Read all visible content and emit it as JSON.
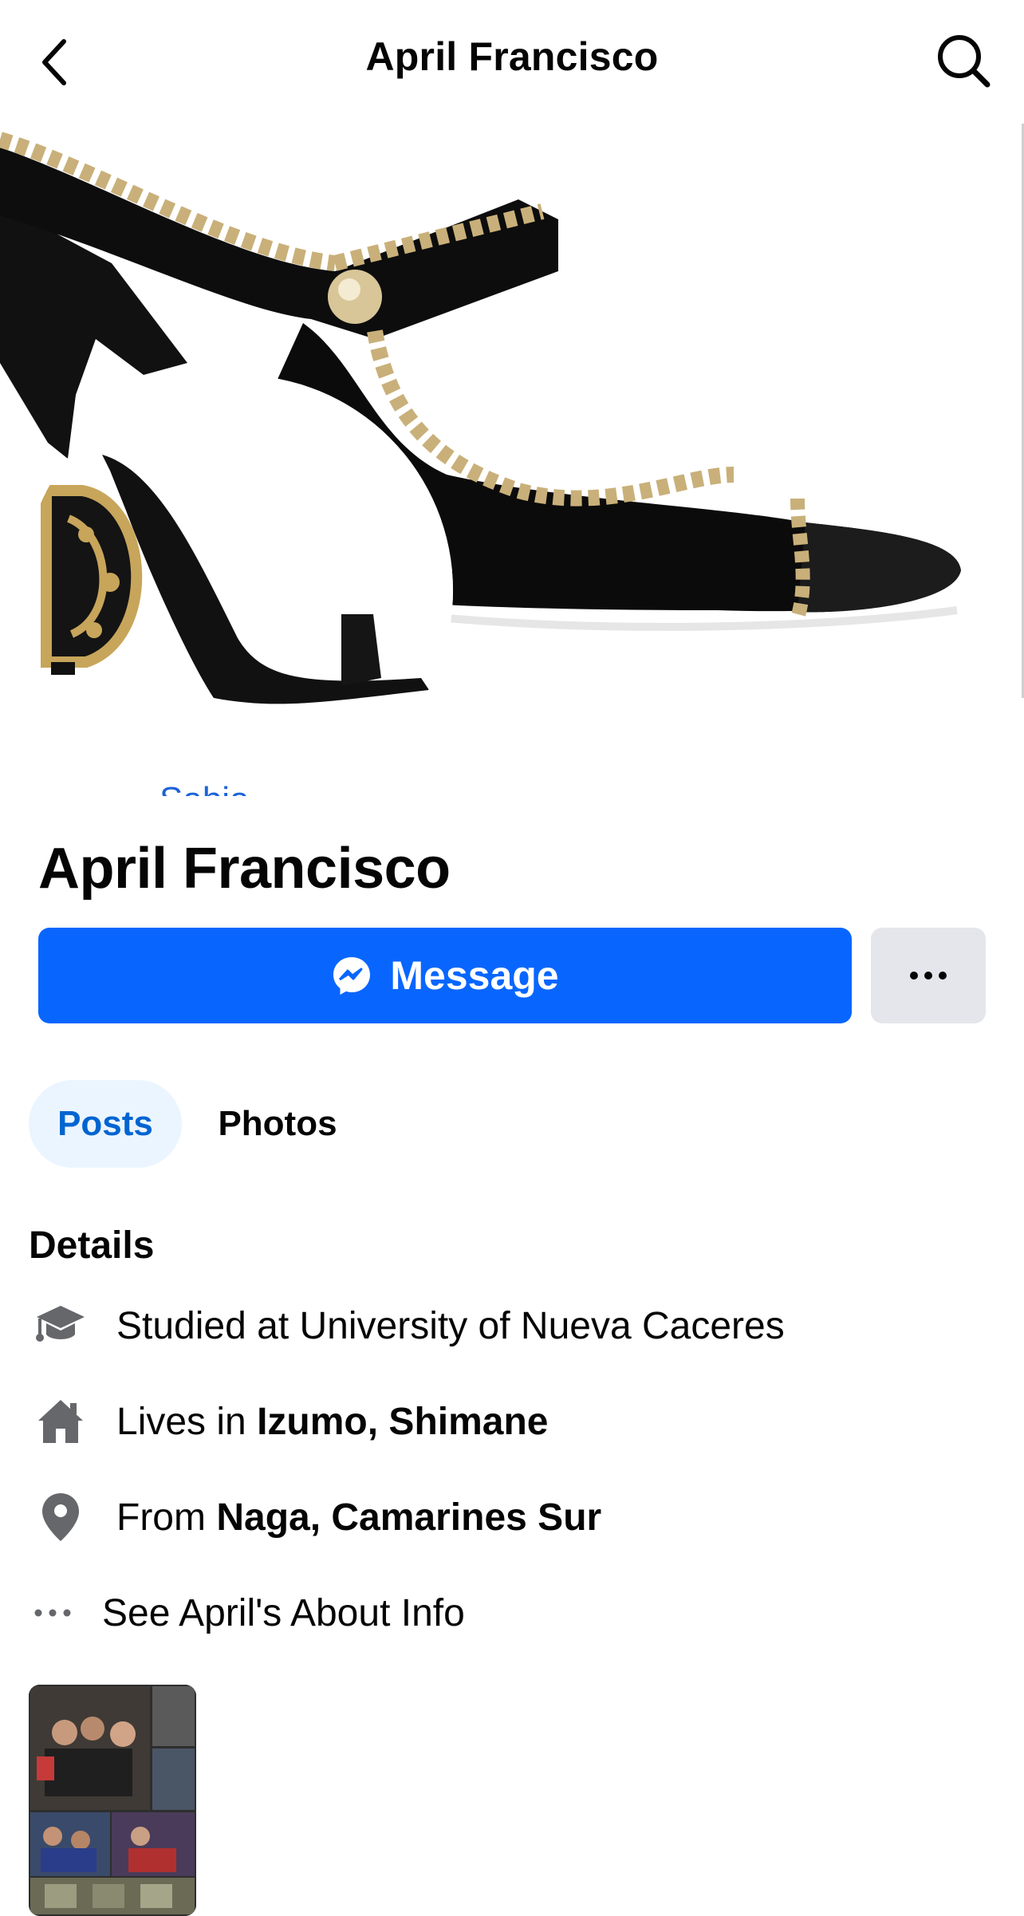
{
  "header": {
    "title": "April Francisco",
    "back_icon": "chevron-left-icon",
    "search_icon": "search-icon"
  },
  "profile": {
    "name": "April Francisco",
    "cover_partial_text": "Sabia"
  },
  "actions": {
    "message_label": "Message",
    "message_icon": "messenger-icon",
    "more_icon": "more-horizontal-icon",
    "primary_color": "#0866ff"
  },
  "tabs": [
    {
      "label": "Posts",
      "active": true
    },
    {
      "label": "Photos",
      "active": false
    }
  ],
  "details": {
    "heading": "Details",
    "study": {
      "icon": "graduation-cap-icon",
      "prefix": "Studied at University of Nueva Caceres"
    },
    "lives": {
      "icon": "home-icon",
      "prefix": "Lives in ",
      "place": "Izumo, Shimane"
    },
    "from": {
      "icon": "location-pin-icon",
      "prefix": "From ",
      "place": "Naga, Camarines Sur"
    },
    "about": {
      "icon": "more-horizontal-icon",
      "label": "See April's About Info"
    }
  }
}
